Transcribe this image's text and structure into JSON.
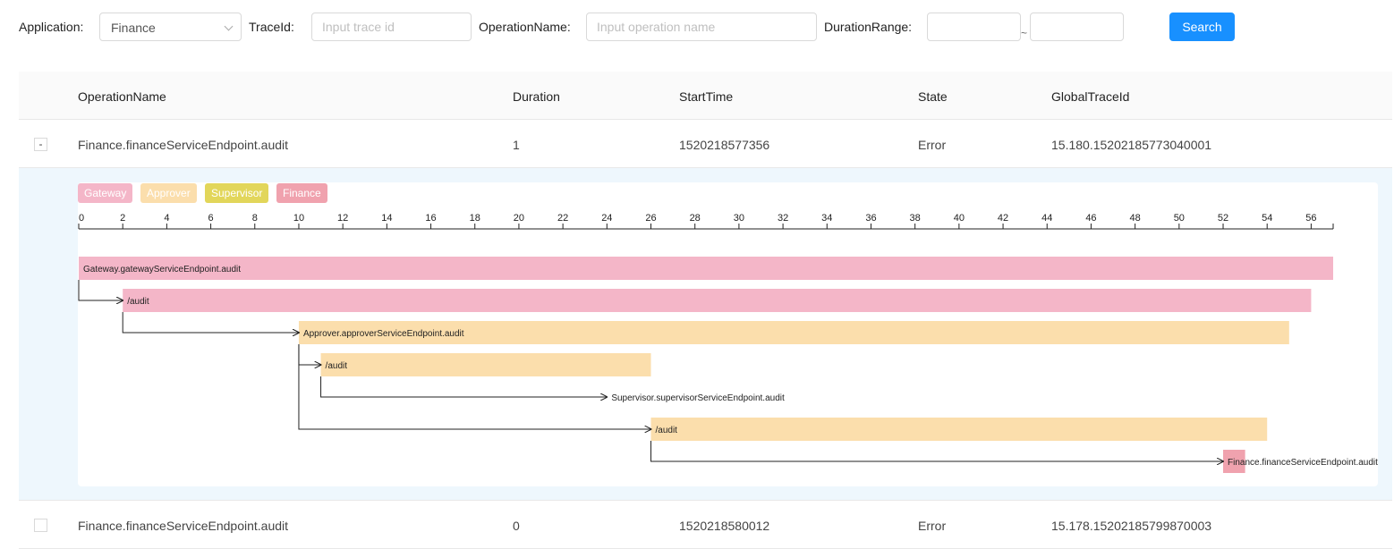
{
  "search": {
    "application_label": "Application:",
    "application_value": "Finance",
    "traceid_label": "TraceId:",
    "traceid_placeholder": "Input trace id",
    "operation_label": "OperationName:",
    "operation_placeholder": "Input operation name",
    "duration_label": "DurationRange:",
    "range_separator": "~",
    "search_button": "Search"
  },
  "table": {
    "columns": [
      "OperationName",
      "Duration",
      "StartTime",
      "State",
      "GlobalTraceId"
    ],
    "rows": [
      {
        "expander": "-",
        "operation": "Finance.financeServiceEndpoint.audit",
        "duration": "1",
        "start": "1520218577356",
        "state": "Error",
        "trace": "15.180.15202185773040001"
      },
      {
        "expander": "",
        "operation": "Finance.financeServiceEndpoint.audit",
        "duration": "0",
        "start": "1520218580012",
        "state": "Error",
        "trace": "15.178.15202185799870003"
      }
    ]
  },
  "trace_view": {
    "legend": [
      {
        "name": "Gateway",
        "color": "#f4b6c8"
      },
      {
        "name": "Approver",
        "color": "#fbdeac"
      },
      {
        "name": "Supervisor",
        "color": "#e2d65a"
      },
      {
        "name": "Finance",
        "color": "#f0a2ae"
      }
    ],
    "axis_ticks": [
      "0",
      "2",
      "4",
      "6",
      "8",
      "10",
      "12",
      "14",
      "16",
      "18",
      "20",
      "22",
      "24",
      "26",
      "28",
      "30",
      "32",
      "34",
      "36",
      "38",
      "40",
      "42",
      "44",
      "46",
      "48",
      "50",
      "52",
      "54",
      "56"
    ],
    "axis_max": 57,
    "spans": [
      {
        "label": "Gateway.gatewayServiceEndpoint.audit",
        "start": 0,
        "end": 57,
        "service": "Gateway",
        "parent": null
      },
      {
        "label": "/audit",
        "start": 2,
        "end": 56,
        "service": "Gateway",
        "parent": 0
      },
      {
        "label": "Approver.approverServiceEndpoint.audit",
        "start": 10,
        "end": 55,
        "service": "Approver",
        "parent": 1
      },
      {
        "label": "/audit",
        "start": 11,
        "end": 26,
        "service": "Approver",
        "parent": 2
      },
      {
        "label": "Supervisor.supervisorServiceEndpoint.audit",
        "start": 24,
        "end": 24,
        "service": "Supervisor",
        "parent": 3
      },
      {
        "label": "/audit",
        "start": 26,
        "end": 54,
        "service": "Approver",
        "parent": 2
      },
      {
        "label": "Finance.financeServiceEndpoint.audit",
        "start": 52,
        "end": 53,
        "service": "Finance",
        "parent": 5
      }
    ]
  }
}
